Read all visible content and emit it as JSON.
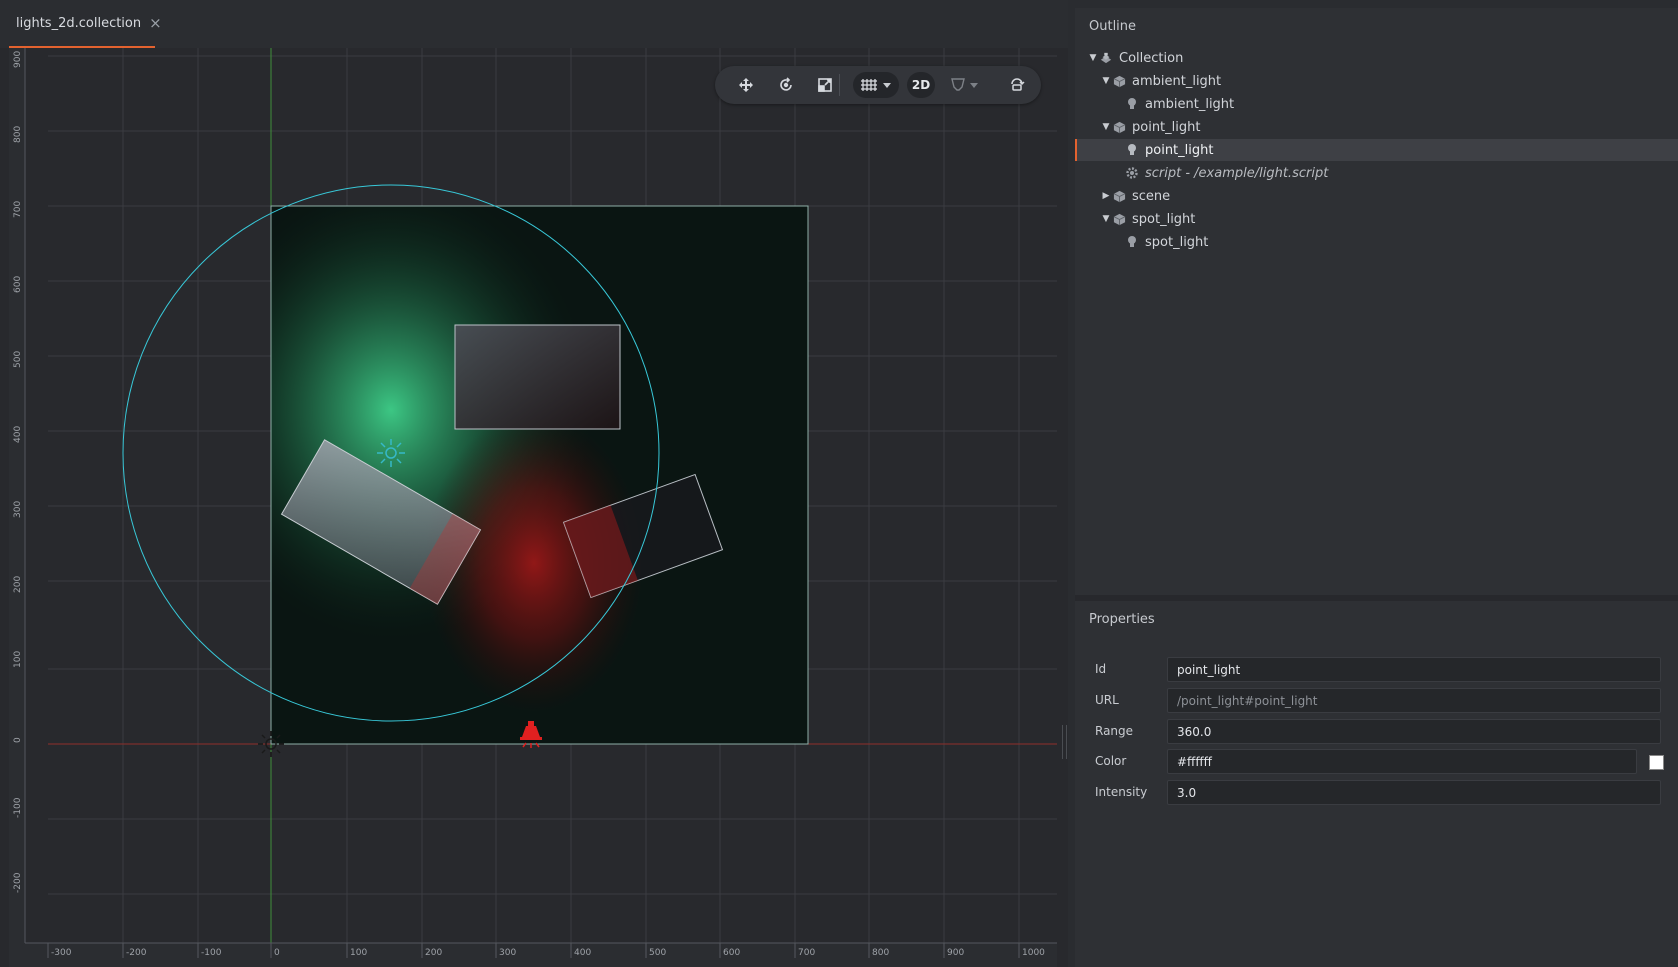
{
  "tab": {
    "title": "lights_2d.collection",
    "close": "×"
  },
  "toolbar": {
    "mode_2d": "2D"
  },
  "viewport": {
    "y_ticks": [
      "900",
      "800",
      "700",
      "600",
      "500",
      "400",
      "300",
      "200",
      "100",
      "0",
      "-100",
      "-200"
    ],
    "x_ticks": [
      "-300",
      "-200",
      "-100",
      "0",
      "100",
      "200",
      "300",
      "400",
      "500",
      "600",
      "700",
      "800",
      "900",
      "1000"
    ]
  },
  "outline": {
    "title": "Outline",
    "items": [
      {
        "label": "Collection",
        "icon": "collection-icon"
      },
      {
        "label": "ambient_light",
        "icon": "game-object-icon"
      },
      {
        "label": "ambient_light",
        "icon": "light-bulb-icon"
      },
      {
        "label": "point_light",
        "icon": "game-object-icon"
      },
      {
        "label": "point_light",
        "icon": "light-bulb-icon"
      },
      {
        "label": "script - /example/light.script",
        "icon": "gear-icon"
      },
      {
        "label": "scene",
        "icon": "game-object-icon"
      },
      {
        "label": "spot_light",
        "icon": "game-object-icon"
      },
      {
        "label": "spot_light",
        "icon": "light-bulb-icon"
      }
    ]
  },
  "properties": {
    "title": "Properties",
    "id_label": "Id",
    "id_value": "point_light",
    "url_label": "URL",
    "url_value": "/point_light#point_light",
    "range_label": "Range",
    "range_value": "360.0",
    "color_label": "Color",
    "color_value": "#ffffff",
    "intensity_label": "Intensity",
    "intensity_value": "3.0"
  },
  "colors": {
    "accent": "#e3622f",
    "point_light": "#3fd08a",
    "spot_light": "#e02020",
    "range_circle": "#38c8d8"
  }
}
